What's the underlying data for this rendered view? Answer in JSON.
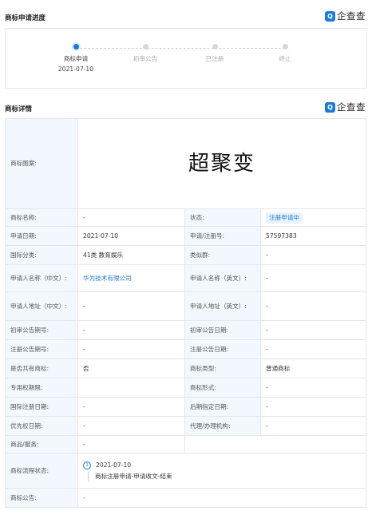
{
  "progress": {
    "title": "商标申请进度",
    "brand_text": "企查查",
    "steps": [
      {
        "label": "商标申请",
        "date": "2021-07-10",
        "active": true
      },
      {
        "label": "初审公告",
        "date": "",
        "active": false
      },
      {
        "label": "已注册",
        "date": "",
        "active": false
      },
      {
        "label": "终止",
        "date": "",
        "active": false
      }
    ]
  },
  "details": {
    "title": "商标详情",
    "brand_text": "企查查",
    "image_label": "商标图案:",
    "trademark_text": "超聚变",
    "rows": [
      {
        "l1": "商标名称:",
        "v1": "-",
        "l2": "状态:",
        "v2": "注册申请中"
      },
      {
        "l1": "申请日期:",
        "v1": "2021-07-10",
        "l2": "申请/注册号:",
        "v2": "57597383"
      },
      {
        "l1": "国际分类:",
        "v1": "41类 教育娱乐",
        "l2": "类似群:",
        "v2": "-"
      },
      {
        "l1": "申请人名称（中文）:",
        "v1": "华为技术有限公司",
        "l2": "申请人名称（英文）:",
        "v2": "-"
      },
      {
        "l1": "申请人地址（中文）:",
        "v1": "-",
        "l2": "申请人地址（英文）:",
        "v2": "-"
      },
      {
        "l1": "初审公告期号:",
        "v1": "-",
        "l2": "初审公告日期:",
        "v2": "-"
      },
      {
        "l1": "注册公告期号:",
        "v1": "-",
        "l2": "注册公告日期:",
        "v2": "-"
      },
      {
        "l1": "是否共有商标:",
        "v1": "否",
        "l2": "商标类型:",
        "v2": "普通商标"
      },
      {
        "l1": "专用权期限:",
        "v1": "",
        "l2": "商标形式:",
        "v2": "-"
      },
      {
        "l1": "国际注册日期:",
        "v1": "-",
        "l2": "后期指定日期:",
        "v2": "-"
      },
      {
        "l1": "优先权日期:",
        "v1": "-",
        "l2": "代理/办理机构:",
        "v2": "-"
      }
    ],
    "goods_label": "商品/服务:",
    "goods_value": "-",
    "flow_label": "商标流程状态:",
    "flow": {
      "num": "1",
      "date": "2021-07-10",
      "desc": "商标注册申请-申请收文-结束"
    },
    "announce_label": "商标公告:",
    "announce_value": "-"
  }
}
